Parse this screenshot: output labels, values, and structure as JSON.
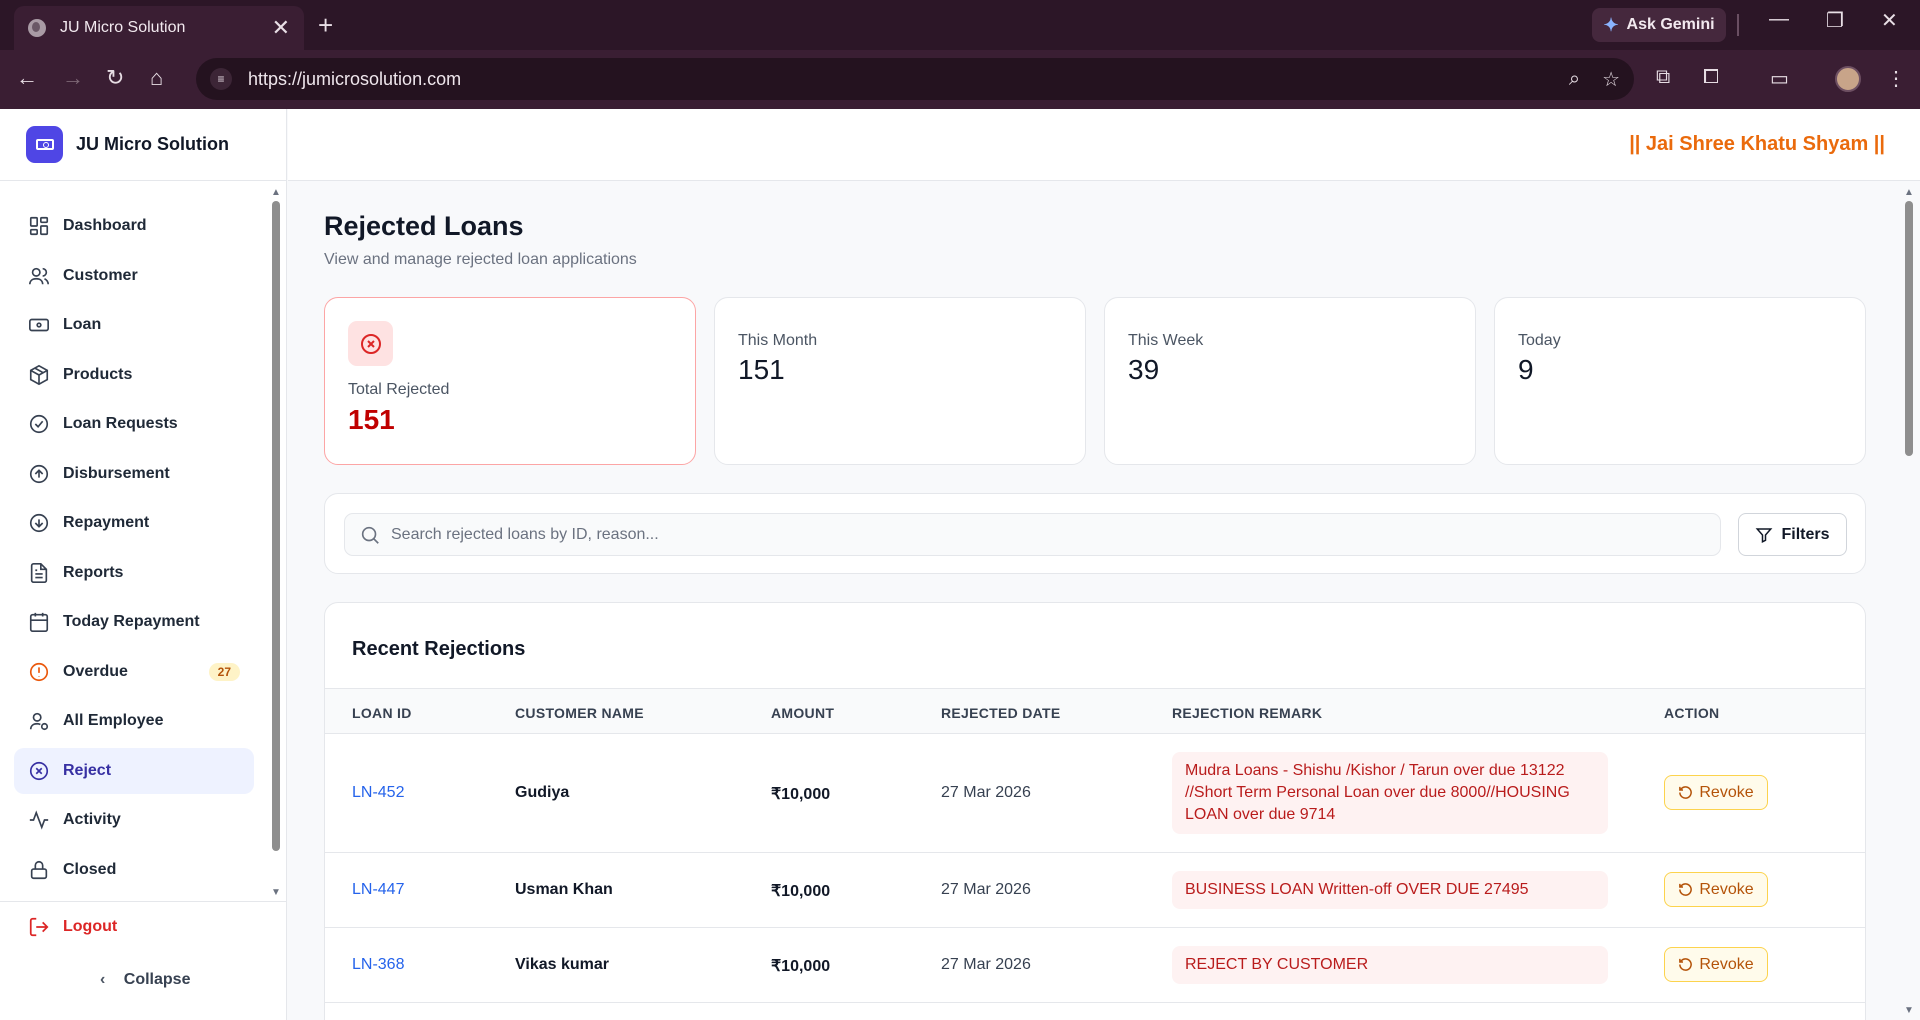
{
  "browser": {
    "tab_title": "JU Micro Solution",
    "tab_close": "✕",
    "new_tab": "+",
    "ask_gemini": "Ask Gemini",
    "url": "https://jumicrosolution.com"
  },
  "sidebar": {
    "brand": "JU Micro Solution",
    "items": [
      {
        "label": "Dashboard",
        "icon": "dashboard-icon"
      },
      {
        "label": "Customer",
        "icon": "users-icon"
      },
      {
        "label": "Loan",
        "icon": "banknote-icon"
      },
      {
        "label": "Products",
        "icon": "package-icon"
      },
      {
        "label": "Loan Requests",
        "icon": "check-circle-icon"
      },
      {
        "label": "Disbursement",
        "icon": "arrow-up-circle-icon"
      },
      {
        "label": "Repayment",
        "icon": "arrow-down-circle-icon"
      },
      {
        "label": "Reports",
        "icon": "file-text-icon"
      },
      {
        "label": "Today Repayment",
        "icon": "calendar-icon"
      },
      {
        "label": "Overdue",
        "icon": "alert-circle-icon",
        "badge": "27"
      },
      {
        "label": "All Employee",
        "icon": "user-cog-icon"
      },
      {
        "label": "Reject",
        "icon": "x-circle-icon",
        "active": true
      },
      {
        "label": "Activity",
        "icon": "activity-icon"
      },
      {
        "label": "Closed",
        "icon": "lock-icon"
      }
    ],
    "logout": "Logout",
    "collapse": "Collapse"
  },
  "header": {
    "blessing": "|| Jai Shree Khatu Shyam ||"
  },
  "page": {
    "title": "Rejected Loans",
    "subtitle": "View and manage rejected loan applications"
  },
  "stats": {
    "total": {
      "label": "Total Rejected",
      "value": "151"
    },
    "month": {
      "label": "This Month",
      "value": "151"
    },
    "week": {
      "label": "This Week",
      "value": "39"
    },
    "today": {
      "label": "Today",
      "value": "9"
    }
  },
  "search": {
    "placeholder": "Search rejected loans by ID, reason...",
    "filters_label": "Filters"
  },
  "table": {
    "title": "Recent Rejections",
    "columns": [
      "LOAN ID",
      "CUSTOMER NAME",
      "AMOUNT",
      "REJECTED DATE",
      "REJECTION REMARK",
      "ACTION"
    ],
    "rows": [
      {
        "id": "LN-452",
        "name": "Gudiya",
        "amount": "₹10,000",
        "date": "27 Mar 2026",
        "remark": "Mudra Loans - Shishu /Kishor / Tarun over due 13122 //Short Term Personal Loan over due 8000//HOUSING LOAN over due 9714",
        "action": "Revoke"
      },
      {
        "id": "LN-447",
        "name": "Usman Khan",
        "amount": "₹10,000",
        "date": "27 Mar 2026",
        "remark": "BUSINESS LOAN Written-off OVER DUE 27495",
        "action": "Revoke"
      },
      {
        "id": "LN-368",
        "name": "Vikas kumar",
        "amount": "₹10,000",
        "date": "27 Mar 2026",
        "remark": "REJECT BY CUSTOMER",
        "action": "Revoke"
      }
    ]
  },
  "colors": {
    "accent": "#4f46e5",
    "danger": "#c00000",
    "warning": "#b45309",
    "blessing": "#ea6a0c"
  }
}
